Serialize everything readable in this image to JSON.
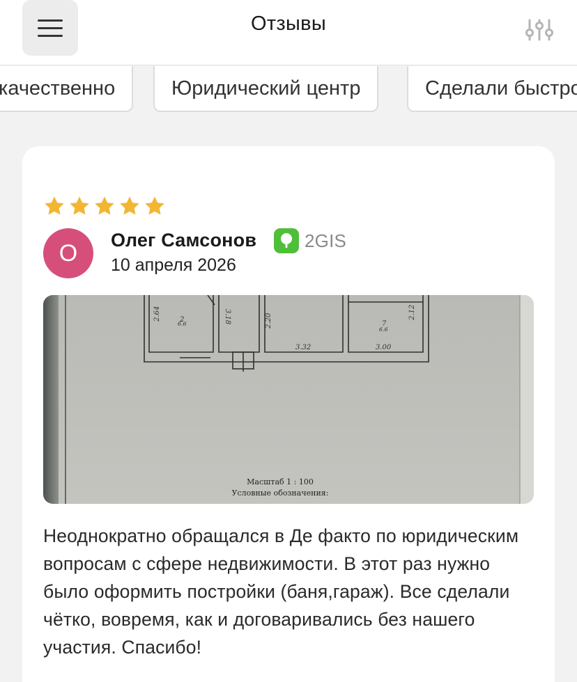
{
  "header": {
    "title": "Отзывы",
    "menu_icon": "hamburger-menu-icon",
    "filter_icon": "sliders-filter-icon"
  },
  "chips": [
    {
      "label": "качественно"
    },
    {
      "label": "Юридический центр"
    },
    {
      "label": "Сделали быстро"
    }
  ],
  "review": {
    "rating": 5,
    "star_color": "#f2b632",
    "author": {
      "initial": "О",
      "name": "Олег Самсонов",
      "avatar_color": "#d64f7b"
    },
    "source": {
      "name": "2GIS",
      "color": "#4fbf3a"
    },
    "date": "10 апреля 2026",
    "photo": {
      "dims": {
        "d1": "2.64",
        "d2": "3.18",
        "d3": "2.20",
        "d4": "3.32",
        "d5": "3.00",
        "d6": "2.12",
        "r1": "2",
        "r1b": "6.6",
        "r2": "7",
        "r2b": "6.6"
      },
      "scale_label": "Масштаб 1 : 100",
      "legend_label": "Условные обозначения:"
    },
    "text": "Неоднократно обращался в Де факто по юридическим вопросам с сфере недвижимости. В этот раз нужно было оформить постройки (баня,гараж). Все сделали чётко, вовремя, как и договаривались без нашего участия. Спасибо!"
  }
}
